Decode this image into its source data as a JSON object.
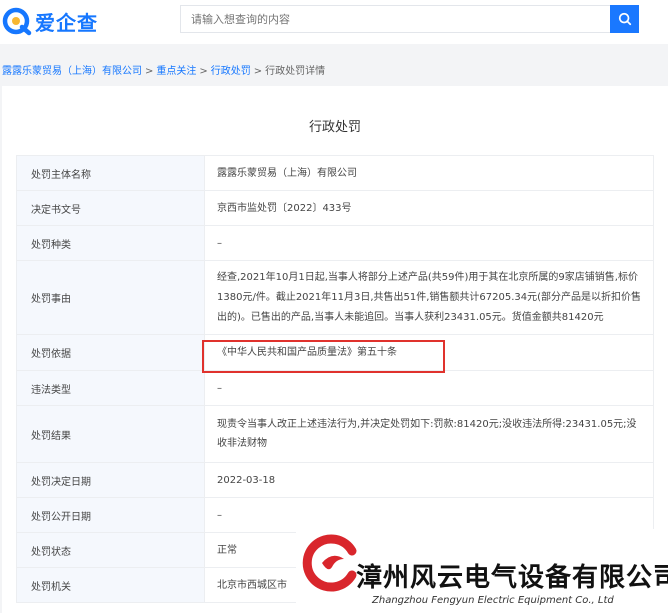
{
  "header": {
    "logo_text": "爱企查",
    "search_placeholder": "请输入想查询的内容"
  },
  "breadcrumb": {
    "items": [
      "露露乐蒙贸易（上海）有限公司",
      "重点关注",
      "行政处罚"
    ],
    "current": "行政处罚详情",
    "separator": ">"
  },
  "main": {
    "title": "行政处罚",
    "rows": [
      {
        "label": "处罚主体名称",
        "value": "露露乐蒙贸易（上海）有限公司"
      },
      {
        "label": "决定书文号",
        "value": "京西市监处罚〔2022〕433号"
      },
      {
        "label": "处罚种类",
        "value": "–"
      },
      {
        "label": "处罚事由",
        "value": "经查,2021年10月1日起,当事人将部分上述产品(共59件)用于其在北京所属的9家店铺销售,标价1380元/件。截止2021年11月3日,共售出51件,销售额共计67205.34元(部分产品是以折扣价售出的)。已售出的产品,当事人未能追回。当事人获利23431.05元。货值金额共81420元"
      },
      {
        "label": "处罚依据",
        "value": "《中华人民共和国产品质量法》第五十条"
      },
      {
        "label": "违法类型",
        "value": "–"
      },
      {
        "label": "处罚结果",
        "value": "现责令当事人改正上述违法行为,并决定处罚如下:罚款:81420元;没收违法所得:23431.05元;没收非法财物"
      },
      {
        "label": "处罚决定日期",
        "value": "2022-03-18"
      },
      {
        "label": "处罚公开日期",
        "value": "–"
      },
      {
        "label": "处罚状态",
        "value": "正常"
      },
      {
        "label": "处罚机关",
        "value": "北京市西城区市"
      }
    ]
  },
  "watermark": {
    "company_cn": "漳州风云电气设备有限公司",
    "company_en": "Zhangzhou Fengyun Electric Equipment Co., Ltd"
  },
  "colors": {
    "brand": "#1677ff",
    "highlight": "#e0322d",
    "label_bg": "#f5f8fd"
  },
  "icons": {
    "logo": "aiqicha-q-logo",
    "search": "search-icon",
    "watermark": "fengyun-logo"
  }
}
